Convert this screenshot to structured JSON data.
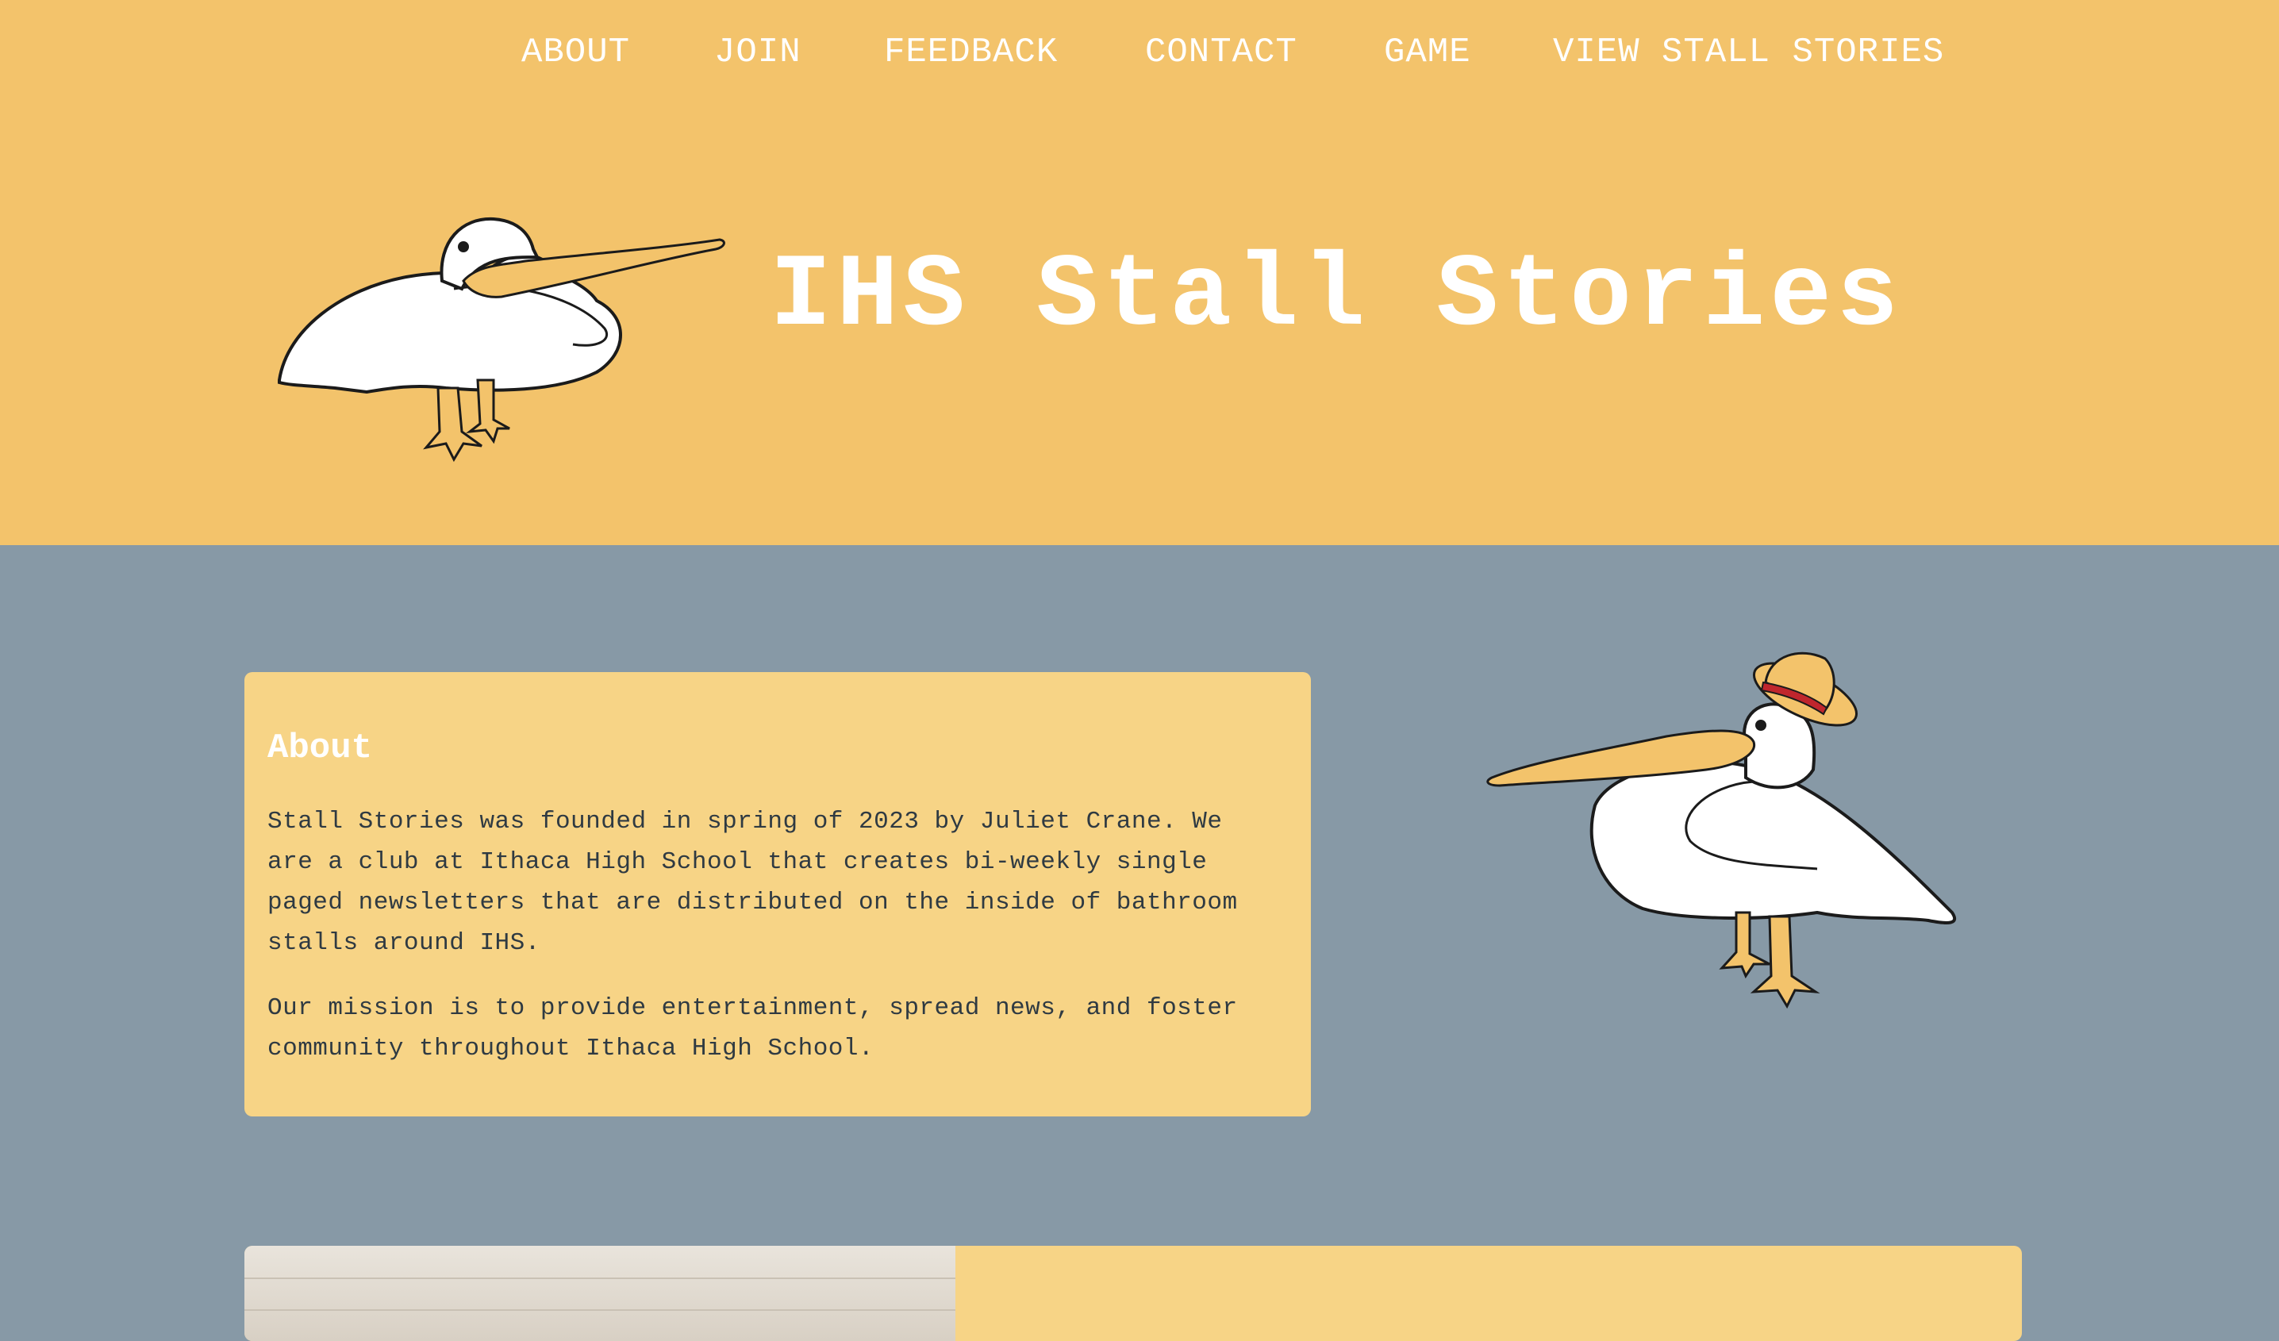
{
  "nav": {
    "items": [
      {
        "label": "ABOUT"
      },
      {
        "label": "JOIN"
      },
      {
        "label": "FEEDBACK"
      },
      {
        "label": "CONTACT"
      },
      {
        "label": "GAME"
      },
      {
        "label": "VIEW STALL STORIES"
      }
    ]
  },
  "header": {
    "title": "IHS Stall Stories",
    "background_color": "#f3c36b"
  },
  "about": {
    "heading": "About",
    "paragraphs": [
      "Stall Stories was founded in spring of 2023 by Juliet Crane. We are a club at Ithaca High School that creates bi-weekly single paged newsletters that are distributed on the inside of bathroom stalls around IHS.",
      "Our mission is to provide entertainment, spread news, and foster community throughout Ithaca High School."
    ],
    "card_color": "#f7d486"
  },
  "icons": {
    "hero": "pelican-icon",
    "about_side": "pelican-with-hat-icon"
  },
  "colors": {
    "main_background": "#8799a6",
    "text_white": "#ffffff",
    "text_dark": "#2f3a42"
  }
}
